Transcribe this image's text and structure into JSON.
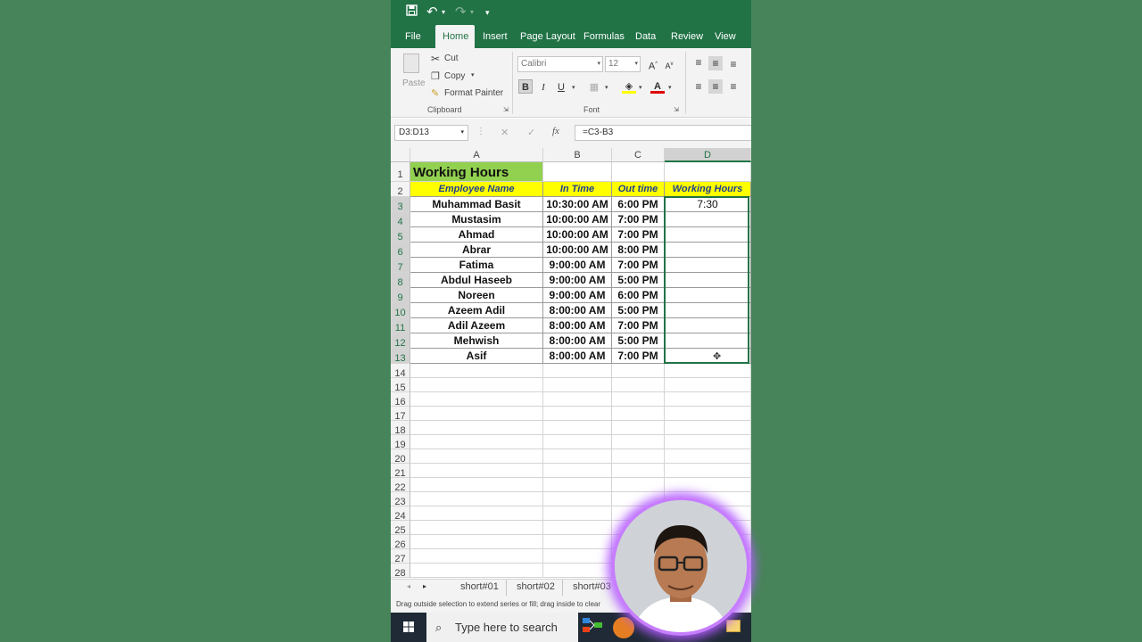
{
  "colors": {
    "brand": "#217346",
    "title_fill": "#92d050",
    "header_fill": "#ffff00",
    "header_text": "#1f3f8f",
    "background": "#478459"
  },
  "tabs": [
    "File",
    "Home",
    "Insert",
    "Page Layout",
    "Formulas",
    "Data",
    "Review",
    "View"
  ],
  "active_tab": "Home",
  "clipboard": {
    "paste": "Paste",
    "cut": "Cut",
    "copy": "Copy",
    "format_painter": "Format Painter",
    "label": "Clipboard"
  },
  "font": {
    "name": "Calibri",
    "size": "12",
    "label": "Font",
    "bold": "B",
    "italic": "I",
    "underline": "U",
    "grow": "A",
    "shrink": "A",
    "color_a": "A"
  },
  "formula_bar": {
    "name_box": "D3:D13",
    "formula": "=C3-B3",
    "fx": "fx",
    "cancel": "✕",
    "enter": "✓"
  },
  "columns": [
    "A",
    "B",
    "C",
    "D"
  ],
  "selected_column": "D",
  "rows": [
    "1",
    "2",
    "3",
    "4",
    "5",
    "6",
    "7",
    "8",
    "9",
    "10",
    "11",
    "12",
    "13",
    "14",
    "15",
    "16",
    "17",
    "18",
    "19",
    "20",
    "21",
    "22",
    "23",
    "24",
    "25",
    "26",
    "27",
    "28"
  ],
  "sheet": {
    "title": "Working Hours",
    "headers": [
      "Employee Name",
      "In Time",
      "Out time",
      "Working Hours"
    ],
    "data": [
      [
        "Muhammad Basit",
        "10:30:00 AM",
        "6:00 PM",
        "7:30"
      ],
      [
        "Mustasim",
        "10:00:00 AM",
        "7:00 PM",
        ""
      ],
      [
        "Ahmad",
        "10:00:00 AM",
        "7:00 PM",
        ""
      ],
      [
        "Abrar",
        "10:00:00 AM",
        "8:00 PM",
        ""
      ],
      [
        "Fatima",
        "9:00:00 AM",
        "7:00 PM",
        ""
      ],
      [
        "Abdul Haseeb",
        "9:00:00 AM",
        "5:00 PM",
        ""
      ],
      [
        "Noreen",
        "9:00:00 AM",
        "6:00 PM",
        ""
      ],
      [
        "Azeem Adil",
        "8:00:00 AM",
        "5:00 PM",
        ""
      ],
      [
        "Adil Azeem",
        "8:00:00 AM",
        "7:00 PM",
        ""
      ],
      [
        "Mehwish",
        "8:00:00 AM",
        "5:00 PM",
        ""
      ],
      [
        "Asif",
        "8:00:00 AM",
        "7:00 PM",
        ""
      ]
    ]
  },
  "sheet_tabs": [
    "short#01",
    "short#02",
    "short#03"
  ],
  "status": "Drag outside selection to extend series or fill; drag inside to clear",
  "taskbar": {
    "search_placeholder": "Type here to search"
  }
}
